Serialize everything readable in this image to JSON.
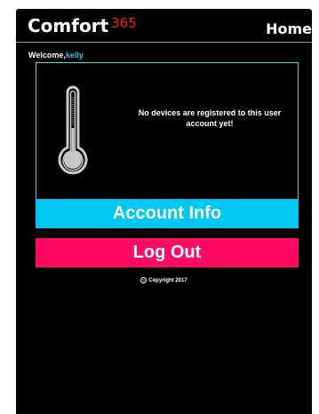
{
  "header": {
    "brand_name": "Comfort",
    "brand_number": "365",
    "home_label": "Home"
  },
  "welcome": {
    "prefix": "Welcome,",
    "username": "kelly"
  },
  "devices": {
    "empty_message": "No devices are registered to this user account yet!"
  },
  "actions": {
    "account_info_label": "Account Info",
    "logout_label": "Log Out"
  },
  "footer": {
    "copyright_icon": "©",
    "copyright_text": "Copyright 2017"
  },
  "colors": {
    "background": "#000000",
    "brand_number": "#ff1a1a",
    "username": "#3ab6e8",
    "panel_border": "#4fd6d6",
    "account_button": "#00c8f4",
    "logout_button": "#ff0a63"
  },
  "icons": {
    "device_placeholder": "thermometer-icon",
    "copyright": "copyright-icon"
  }
}
